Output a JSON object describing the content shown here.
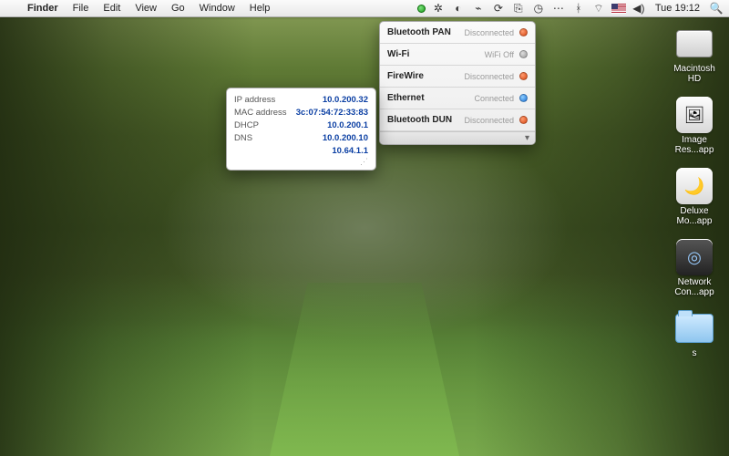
{
  "menubar": {
    "app": "Finder",
    "items": [
      "File",
      "Edit",
      "View",
      "Go",
      "Window",
      "Help"
    ],
    "clock": "Tue 19:12"
  },
  "desktop_icons": [
    {
      "label": "Macintosh HD",
      "kind": "hd"
    },
    {
      "label": "Image Res...app",
      "kind": "app"
    },
    {
      "label": "Deluxe Mo...app",
      "kind": "app"
    },
    {
      "label": "Network Con...app",
      "kind": "app",
      "glyph": "◎"
    },
    {
      "label": "s",
      "kind": "folder"
    }
  ],
  "network_panel": {
    "rows": [
      {
        "name": "Bluetooth PAN",
        "status": "Disconnected",
        "dot": "red"
      },
      {
        "name": "Wi-Fi",
        "status": "WiFi Off",
        "dot": "gray"
      },
      {
        "name": "FireWire",
        "status": "Disconnected",
        "dot": "red"
      },
      {
        "name": "Ethernet",
        "status": "Connected",
        "dot": "blue"
      },
      {
        "name": "Bluetooth DUN",
        "status": "Disconnected",
        "dot": "red"
      }
    ]
  },
  "detail_panel": {
    "rows": [
      {
        "k": "IP address",
        "v": "10.0.200.32"
      },
      {
        "k": "MAC address",
        "v": "3c:07:54:72:33:83"
      },
      {
        "k": "DHCP",
        "v": "10.0.200.1"
      },
      {
        "k": "DNS",
        "v": "10.0.200.10"
      },
      {
        "k": "",
        "v": "10.64.1.1"
      }
    ]
  }
}
